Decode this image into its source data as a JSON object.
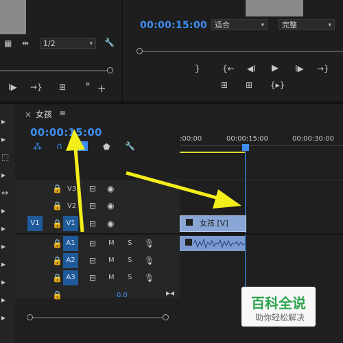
{
  "source_monitor": {
    "zoom_value": "1/2",
    "icons": [
      "film-icon",
      "mark-in-out-icon",
      "wrench-icon"
    ]
  },
  "program_monitor": {
    "timecode": "00:00:15:00",
    "fit_select": "适合",
    "quality_select": "完整"
  },
  "timeline": {
    "tab_close": "×",
    "sequence_name": "女孩",
    "menu_glyph": "≡",
    "timecode": "00:00:15:00",
    "ruler_labels": [
      ":00:00",
      "00:00:15:00",
      "00:00:30:00"
    ],
    "tracks": {
      "V3": "V3",
      "V2": "V2",
      "V1": "V1",
      "V1_source": "V1",
      "A1": "A1",
      "A2": "A2",
      "A3": "A3",
      "M": "M",
      "S": "S",
      "master_volume": "0.0"
    },
    "clip_video_label": "女孩 [V]"
  },
  "watermark": {
    "title": "百科全说",
    "subtitle": "助你轻松解决"
  },
  "colors": {
    "accent_blue": "#3d8ef0",
    "arrow_yellow": "#f4ef1a",
    "track_blue": "#1f5a9a"
  }
}
